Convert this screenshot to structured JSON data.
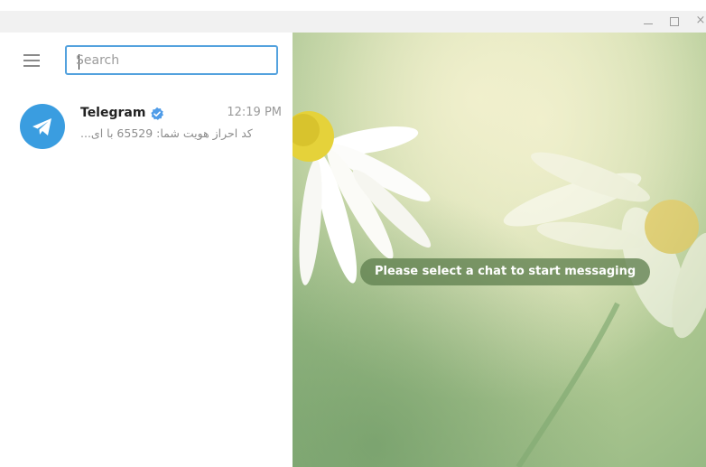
{
  "window": {
    "minimize_symbol": "_",
    "maximize_symbol": "□",
    "close_symbol": "×"
  },
  "sidebar": {
    "menu_icon": "hamburger-menu-icon",
    "search": {
      "placeholder": "Search",
      "value": ""
    },
    "chats": [
      {
        "name": "Telegram",
        "verified": true,
        "time": "12:19 PM",
        "preview": "کد احراز هویت شما: 65529 با ای...",
        "avatar_icon": "paper-plane-icon",
        "avatar_color": "#3a9de0"
      }
    ]
  },
  "main": {
    "empty_message": "Please select a chat to start messaging"
  },
  "colors": {
    "accent": "#54a2de",
    "verified": "#4f9ce8"
  }
}
